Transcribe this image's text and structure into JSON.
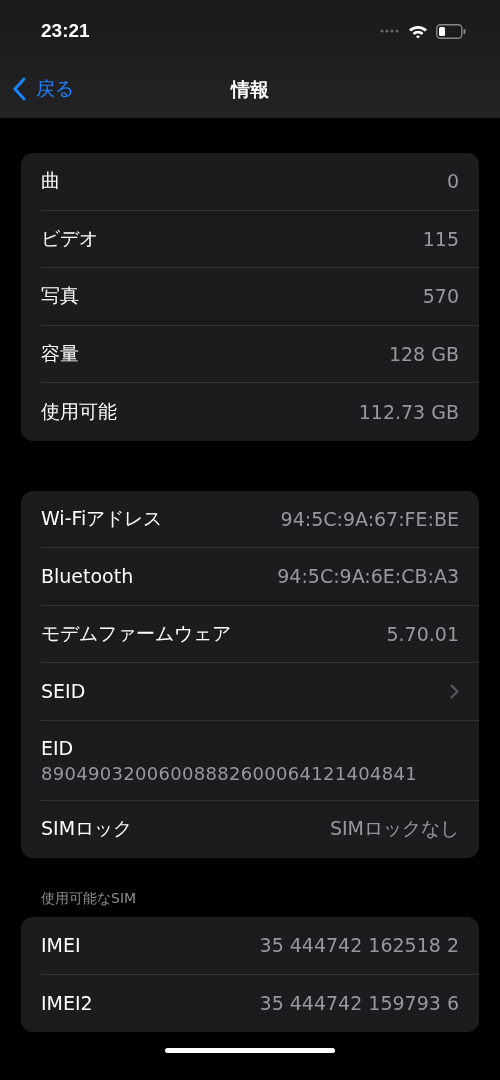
{
  "status_bar": {
    "time": "23:21"
  },
  "nav": {
    "back": "戻る",
    "title": "情報"
  },
  "groups": [
    {
      "rows": [
        {
          "kind": "value",
          "label": "曲",
          "value": "0"
        },
        {
          "kind": "value",
          "label": "ビデオ",
          "value": "115"
        },
        {
          "kind": "value",
          "label": "写真",
          "value": "570"
        },
        {
          "kind": "value",
          "label": "容量",
          "value": "128 GB"
        },
        {
          "kind": "value",
          "label": "使用可能",
          "value": "112.73 GB"
        }
      ]
    },
    {
      "rows": [
        {
          "kind": "value",
          "label": "Wi-Fiアドレス",
          "value": "94:5C:9A:67:FE:BE"
        },
        {
          "kind": "value",
          "label": "Bluetooth",
          "value": "94:5C:9A:6E:CB:A3"
        },
        {
          "kind": "value",
          "label": "モデムファームウェア",
          "value": "5.70.01"
        },
        {
          "kind": "link",
          "label": "SEID"
        },
        {
          "kind": "stacked",
          "label": "EID",
          "value": "89049032006008882600064121404841"
        },
        {
          "kind": "value",
          "label": "SIMロック",
          "value": "SIMロックなし"
        }
      ]
    },
    {
      "header": "使用可能なSIM",
      "rows": [
        {
          "kind": "value",
          "label": "IMEI",
          "value": "35 444742 162518 2"
        },
        {
          "kind": "value",
          "label": "IMEI2",
          "value": "35 444742 159793 6"
        }
      ]
    }
  ]
}
